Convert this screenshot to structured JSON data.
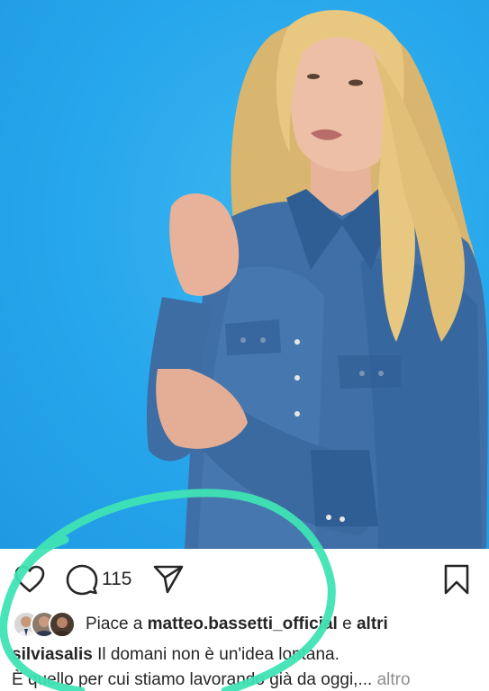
{
  "post": {
    "comment_count": "115",
    "likes": {
      "prefix": "Piace a",
      "user": "matteo.bassetti_official",
      "connector": "e",
      "others": "altri"
    },
    "caption": {
      "author": "silviasalis",
      "line1": "Il domani non è un'idea lontana.",
      "line2": "È quello per cui stiamo lavorando già da oggi,...",
      "more": "altro"
    }
  },
  "icons": {
    "like": "heart-icon",
    "comment": "comment-icon",
    "share": "send-icon",
    "save": "bookmark-icon"
  },
  "colors": {
    "background": "#26a6ec",
    "annotation": "#3fe3b4",
    "text": "#262626",
    "muted": "#8e8e8e"
  }
}
